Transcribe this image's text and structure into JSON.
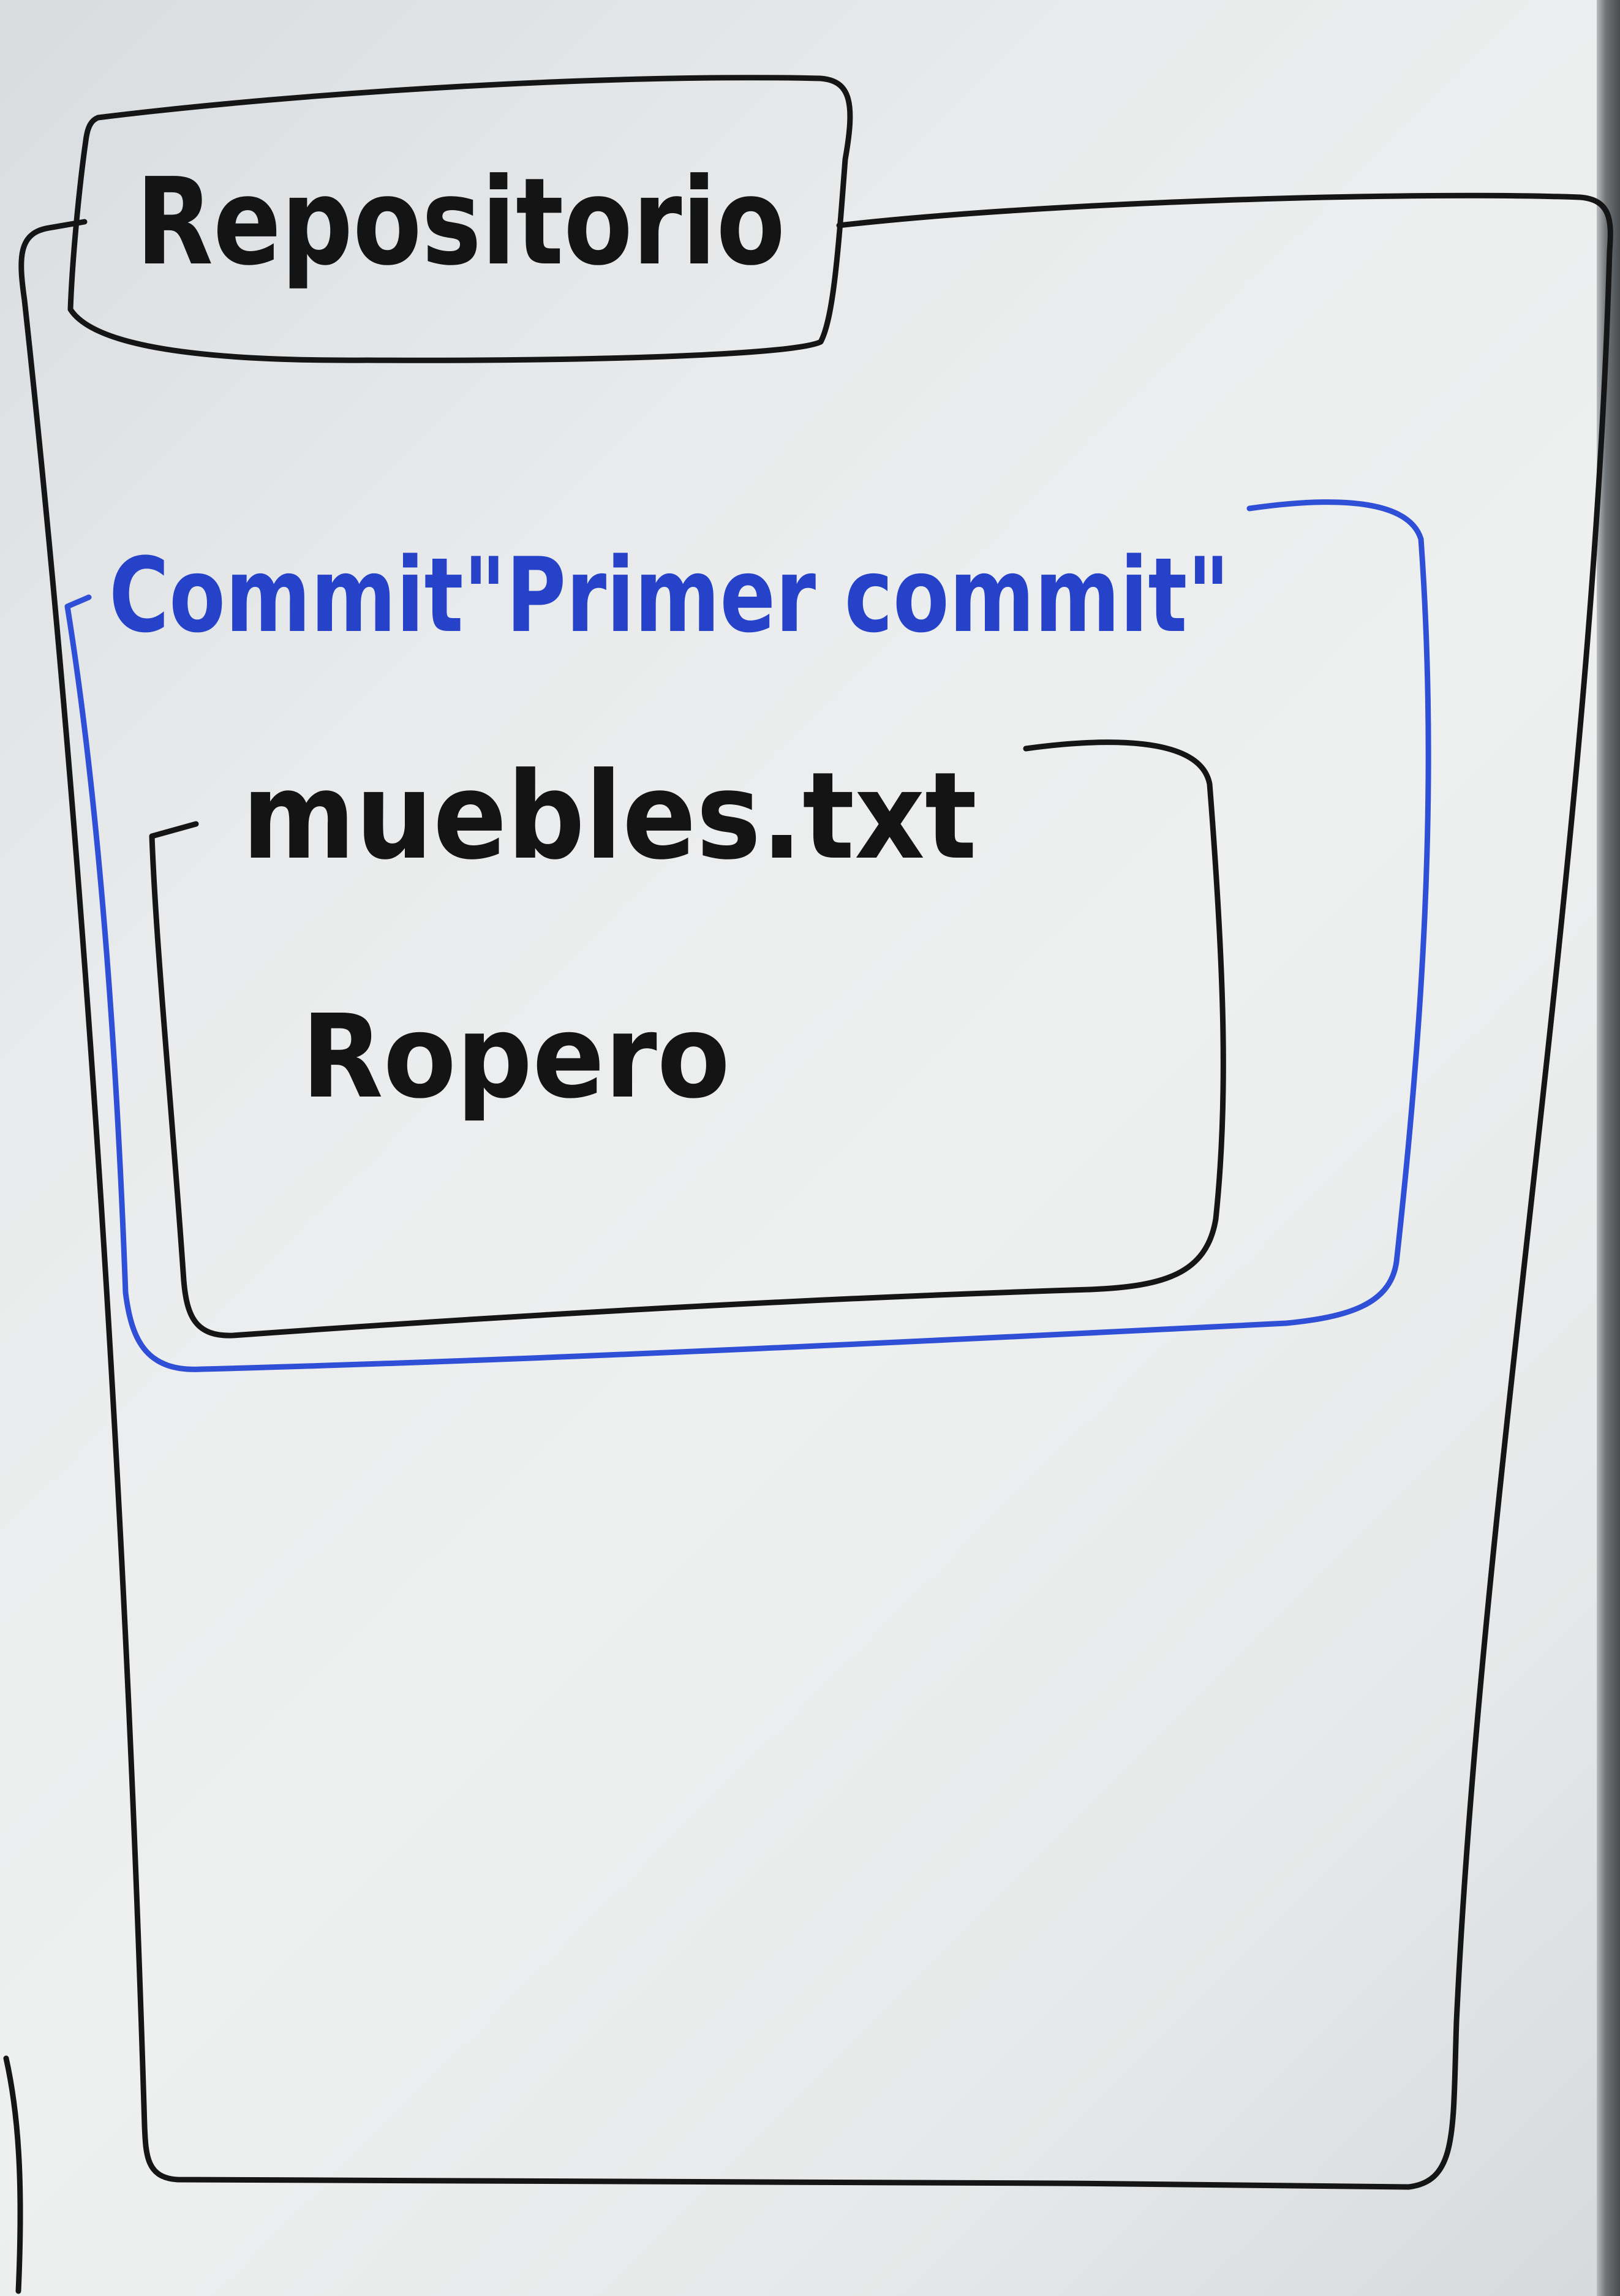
{
  "diagram": {
    "repository_label": "Repositorio",
    "commit_label": "Commit\"Primer commit\"",
    "file_name": "muebles.txt",
    "file_content": "Ropero"
  },
  "colors": {
    "board": "#e9ebec",
    "marker_black": "#151515",
    "marker_blue": "#2f4fd6"
  }
}
